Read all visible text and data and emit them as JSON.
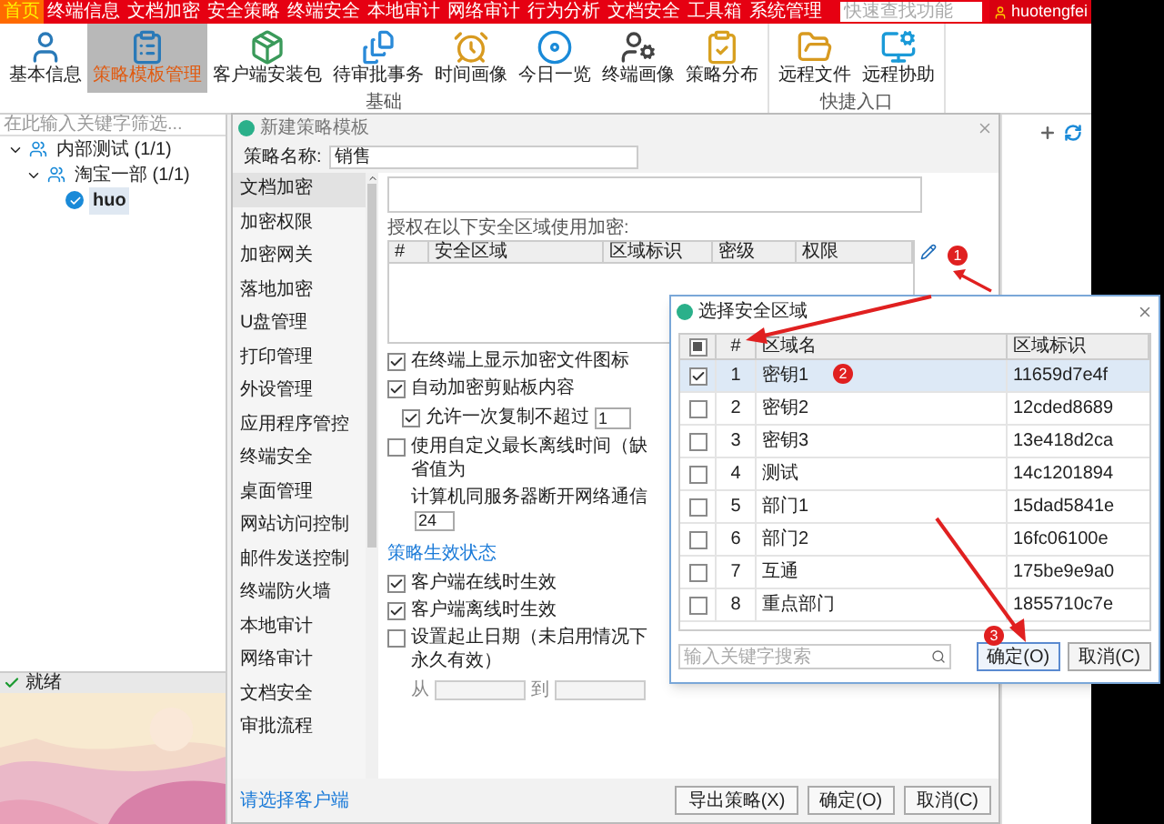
{
  "menu_bar": {
    "items": [
      {
        "label": "首页",
        "selected": true
      },
      {
        "label": "终端信息",
        "selected": false
      },
      {
        "label": "文档加密",
        "selected": false
      },
      {
        "label": "安全策略",
        "selected": false
      },
      {
        "label": "终端安全",
        "selected": false
      },
      {
        "label": "本地审计",
        "selected": false
      },
      {
        "label": "网络审计",
        "selected": false
      },
      {
        "label": "行为分析",
        "selected": false
      },
      {
        "label": "文档安全",
        "selected": false
      },
      {
        "label": "工具箱",
        "selected": false
      },
      {
        "label": "系统管理",
        "selected": false
      }
    ],
    "search": {
      "placeholder": "快速查找功能"
    },
    "user": "huotengfei"
  },
  "ribbon": {
    "groups": [
      {
        "label": "基础",
        "buttons": [
          {
            "label": "基本信息",
            "selected": false
          },
          {
            "label": "策略模板管理",
            "selected": true
          },
          {
            "label": "客户端安装包",
            "selected": false
          },
          {
            "label": "待审批事务",
            "selected": false
          },
          {
            "label": "时间画像",
            "selected": false
          },
          {
            "label": "今日一览",
            "selected": false
          },
          {
            "label": "终端画像",
            "selected": false
          },
          {
            "label": "策略分布",
            "selected": false
          }
        ]
      },
      {
        "label": "快捷入口",
        "buttons": [
          {
            "label": "远程文件",
            "selected": false
          },
          {
            "label": "远程协助",
            "selected": false
          }
        ]
      }
    ]
  },
  "left_panel": {
    "search": {
      "placeholder": "在此输入关键字筛选..."
    },
    "tree": [
      {
        "label": "内部测试 (1/1)",
        "kind": "group",
        "expanded": true,
        "selected": false,
        "children": [
          {
            "label": "淘宝一部 (1/1)",
            "kind": "group",
            "expanded": true,
            "selected": false,
            "children": [
              {
                "label": "huo",
                "kind": "user",
                "selected": true
              }
            ]
          }
        ]
      }
    ]
  },
  "status_bar": {
    "text": "就绪"
  },
  "dialog": {
    "title": "新建策略模板",
    "name_label": "策略名称:",
    "name_value": "销售",
    "nav": [
      {
        "label": "文档加密",
        "selected": true
      },
      {
        "label": "加密权限",
        "selected": false
      },
      {
        "label": "加密网关",
        "selected": false
      },
      {
        "label": "落地加密",
        "selected": false
      },
      {
        "label": "U盘管理",
        "selected": false
      },
      {
        "label": "打印管理",
        "selected": false
      },
      {
        "label": "外设管理",
        "selected": false
      },
      {
        "label": "应用程序管控",
        "selected": false
      },
      {
        "label": "终端安全",
        "selected": false
      },
      {
        "label": "桌面管理",
        "selected": false
      },
      {
        "label": "网站访问控制",
        "selected": false
      },
      {
        "label": "邮件发送控制",
        "selected": false
      },
      {
        "label": "终端防火墙",
        "selected": false
      },
      {
        "label": "本地审计",
        "selected": false
      },
      {
        "label": "网络审计",
        "selected": false
      },
      {
        "label": "文档安全",
        "selected": false
      },
      {
        "label": "审批流程",
        "selected": false
      }
    ],
    "footer_link": "请选择客户端",
    "zones_label": "授权在以下安全区域使用加密:",
    "zones_columns": [
      "#",
      "安全区域",
      "区域标识",
      "密级",
      "权限"
    ],
    "options": [
      {
        "kind": "checkbox",
        "label": "在终端上显示加密文件图标",
        "checked": true
      },
      {
        "kind": "checkbox",
        "label": "自动加密剪贴板内容",
        "checked": true
      },
      {
        "kind": "spin",
        "label": "允许一次复制不超过",
        "checked": true,
        "value": "1"
      },
      {
        "kind": "checkbox",
        "label": "使用自定义最长离线时间（缺省值为",
        "checked": false
      },
      {
        "kind": "input",
        "label": "计算机同服务器断开网络通信",
        "value": "24"
      }
    ],
    "section_title": "策略生效状态",
    "effect_options": [
      {
        "label": "客户端在线时生效",
        "checked": true
      },
      {
        "label": "客户端离线时生效",
        "checked": true
      },
      {
        "label": "设置起止日期（未启用情况下永久有效）",
        "checked": false
      }
    ],
    "date_from_label": "从",
    "date_to_label": "到",
    "buttons": [
      "导出策略(X)",
      "确定(O)",
      "取消(C)"
    ]
  },
  "zone_dialog": {
    "title": "选择安全区域",
    "select_all_partial": true,
    "columns": [
      "#",
      "区域名",
      "区域标识"
    ],
    "rows": [
      {
        "no": "1",
        "name": "密钥1",
        "id": "11659d7e4f",
        "checked": true,
        "selected": true
      },
      {
        "no": "2",
        "name": "密钥2",
        "id": "12cded8689",
        "checked": false,
        "selected": false
      },
      {
        "no": "3",
        "name": "密钥3",
        "id": "13e418d2ca",
        "checked": false,
        "selected": false
      },
      {
        "no": "4",
        "name": "测试",
        "id": "14c1201894",
        "checked": false,
        "selected": false
      },
      {
        "no": "5",
        "name": "部门1",
        "id": "15dad5841e",
        "checked": false,
        "selected": false
      },
      {
        "no": "6",
        "name": "部门2",
        "id": "16fc06100e",
        "checked": false,
        "selected": false
      },
      {
        "no": "7",
        "name": "互通",
        "id": "175be9e9a0",
        "checked": false,
        "selected": false
      },
      {
        "no": "8",
        "name": "重点部门",
        "id": "1855710c7e",
        "checked": false,
        "selected": false
      }
    ],
    "search": {
      "placeholder": "输入关键字搜索"
    },
    "buttons": [
      "确定(O)",
      "取消(C)"
    ]
  },
  "annotations": [
    {
      "label": "1"
    },
    {
      "label": "2"
    },
    {
      "label": "3"
    }
  ]
}
